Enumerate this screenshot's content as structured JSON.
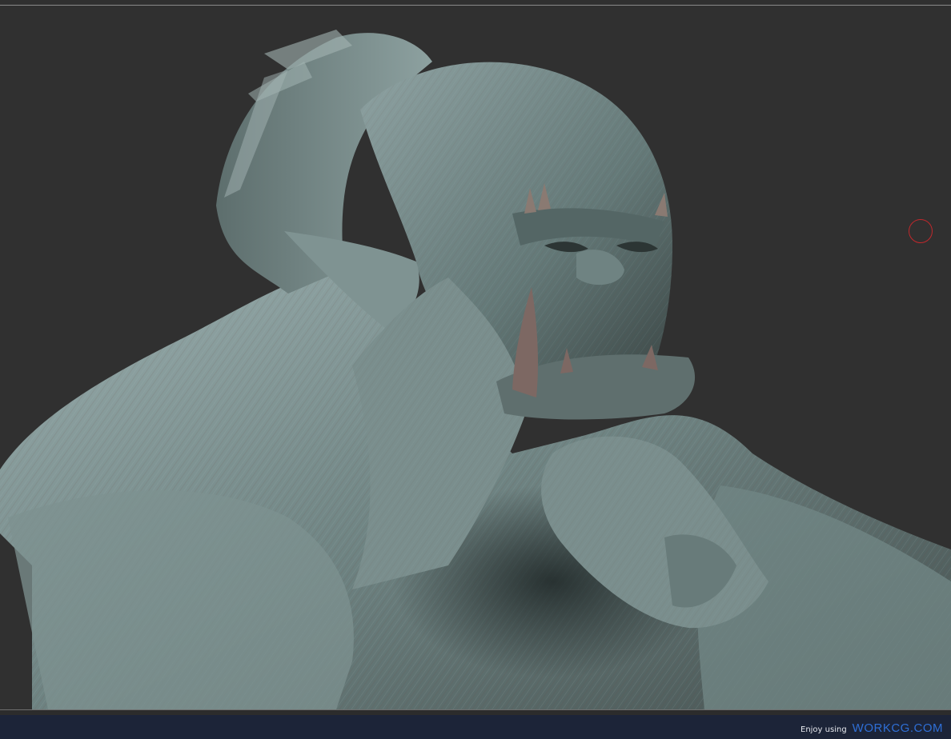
{
  "viewport": {
    "background_color": "#303030",
    "model_colors": {
      "clay_light": "#8fa3a3",
      "clay_mid": "#607574",
      "clay_dark": "#2c3534",
      "cavity_red": "#6b4a44"
    }
  },
  "cursor": {
    "icon": "brush-cursor-icon",
    "color": "#c0282c"
  },
  "footer": {
    "prefix": "Enjoy using",
    "brand": "WORKCG.COM",
    "brand_color": "#2f6fd6",
    "background_color": "#1c2438"
  }
}
